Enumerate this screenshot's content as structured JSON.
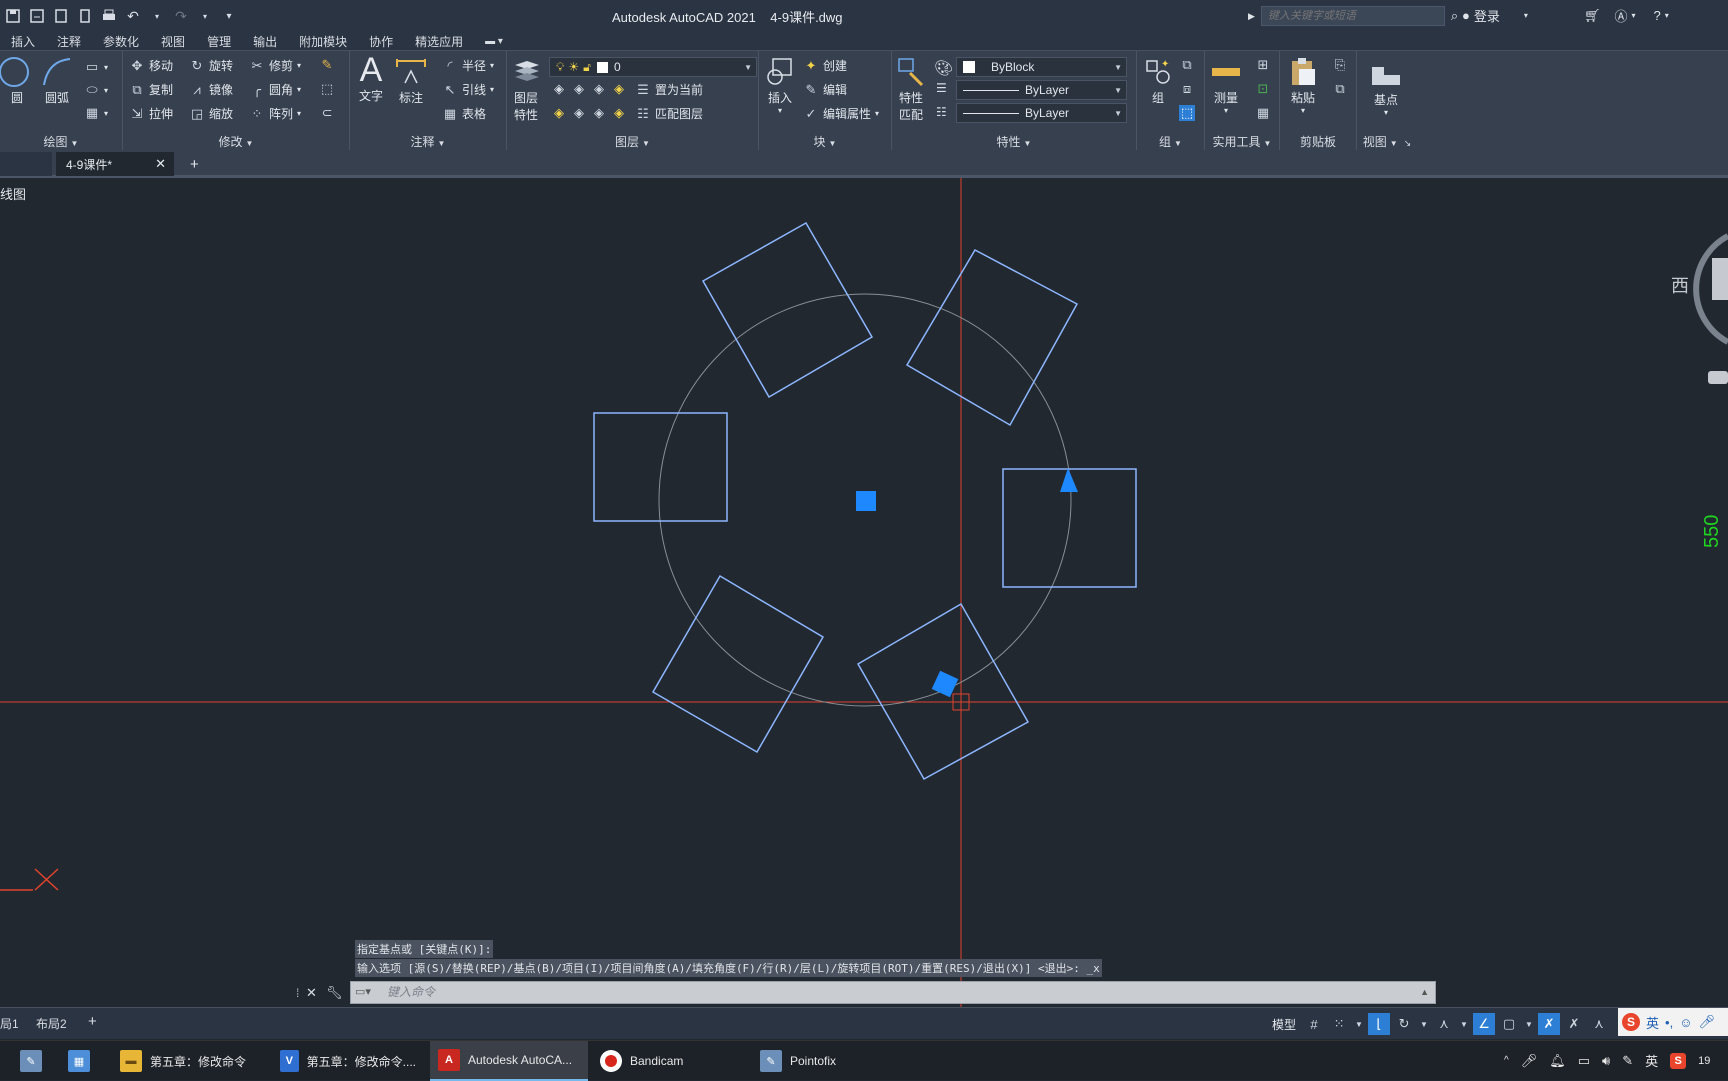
{
  "title": {
    "app": "Autodesk AutoCAD 2021",
    "file": "4-9课件.dwg",
    "search_placeholder": "键入关键字或短语",
    "login": "登录"
  },
  "ribbon_tabs": [
    "插入",
    "注释",
    "参数化",
    "视图",
    "管理",
    "输出",
    "附加模块",
    "协作",
    "精选应用"
  ],
  "panels": {
    "draw": {
      "title": "绘图",
      "circle": "圆",
      "arc": "圆弧"
    },
    "modify": {
      "title": "修改",
      "move": "移动",
      "rotate": "旋转",
      "trim": "修剪",
      "copy": "复制",
      "mirror": "镜像",
      "fillet": "圆角",
      "stretch": "拉伸",
      "scale": "缩放",
      "array": "阵列"
    },
    "annotation": {
      "title": "注释",
      "text": "文字",
      "dimension": "标注",
      "radius": "半径",
      "leader": "引线",
      "table": "表格"
    },
    "layers": {
      "title": "图层",
      "layer_properties_1": "图层",
      "layer_properties_2": "特性",
      "current_layer": "0",
      "set_current": "置为当前",
      "match_layer": "匹配图层"
    },
    "block": {
      "title": "块",
      "insert": "插入",
      "create": "创建",
      "edit": "编辑",
      "edit_attributes": "编辑属性"
    },
    "properties": {
      "title": "特性",
      "match_1": "特性",
      "match_2": "匹配",
      "color": "ByBlock",
      "linetype": "ByLayer",
      "lineweight": "ByLayer"
    },
    "groups": {
      "title": "组",
      "group": "组"
    },
    "utilities": {
      "title": "实用工具",
      "measure": "测量"
    },
    "clipboard": {
      "title": "剪贴板",
      "paste": "粘贴"
    },
    "view": {
      "title": "视图",
      "base": "基点"
    }
  },
  "doc_tabs": {
    "active": "4-9课件*"
  },
  "viewport": {
    "label": "线图",
    "viewcube_west": "西",
    "dim_text": "550"
  },
  "command": {
    "history_1": "指定基点或 [关键点(K)]:",
    "history_2": "输入选项 [源(S)/替换(REP)/基点(B)/项目(I)/项目间角度(A)/填充角度(F)/行(R)/层(L)/旋转项目(ROT)/重置(RES)/退出(X)] <退出>: _x",
    "placeholder": "键入命令"
  },
  "layout_tabs": [
    "局1",
    "布局2"
  ],
  "status": {
    "model": "模型",
    "ime": "英"
  },
  "taskbar": {
    "items": [
      "第五章：修改命令",
      "第五章：修改命令....",
      "Autodesk AutoCA...",
      "Bandicam",
      "Pointofix"
    ],
    "ime": "英",
    "clock": "19"
  },
  "colors": {
    "selection": "#1e88ff",
    "crosshair": "#e0442c",
    "rect": "#8db6ff",
    "circle": "#8a8f96",
    "dim": "#21d321"
  }
}
